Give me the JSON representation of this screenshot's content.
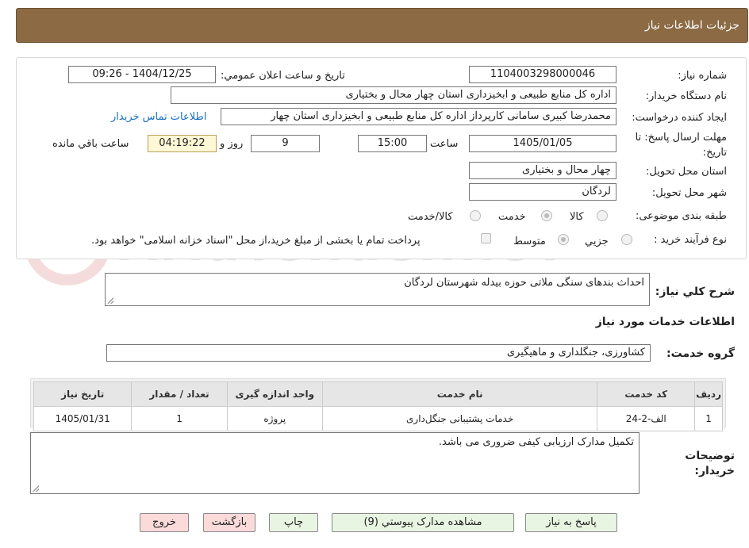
{
  "header": {
    "title": "جزئیات اطلاعات نیاز"
  },
  "form": {
    "need_number_label": "شماره نیاز:",
    "need_number": "1104003298000046",
    "announce_label": "تاریخ و ساعت اعلان عمومي:",
    "announce_value": "1404/12/25 - 09:26",
    "buyer_org_label": "نام دستگاه خریدار:",
    "buyer_org": "اداره کل منابع طبیعی و ابخیزداری استان چهار محال و بختیاری",
    "creator_label": "ایجاد کننده درخواست:",
    "creator": "محمدرضا کبیری سامانی کارپرداز اداره کل منابع طبیعی و ابخیزداری استان چهار",
    "contact_link": "اطلاعات تماس خریدار",
    "deadline_label": "مهلت ارسال پاسخ: تا تاریخ:",
    "deadline_date": "1405/01/05",
    "time_label": "ساعت",
    "deadline_time": "15:00",
    "days": "9",
    "days_label": "روز و",
    "remaining": "04:19:22",
    "remaining_label": "ساعت باقي مانده",
    "province_label": "استان محل تحویل:",
    "province": "چهار محال و بختیاری",
    "city_label": "شهر محل تحویل:",
    "city": "لردگان",
    "category_label": "طبقه بندی موضوعی:",
    "category_options": [
      "کالا",
      "خدمت",
      "کالا/خدمت"
    ],
    "process_label": "نوع فرآیند خرید :",
    "process_options": [
      "جزيي",
      "متوسط"
    ],
    "payment_note": "پرداخت تمام یا بخشی از مبلغ خرید،از محل \"اسناد خزانه اسلامی\" خواهد بود."
  },
  "summary": {
    "label": "شرح کلي نیاز:",
    "text": "احداث بندهای سنگی ملاتی حوزه بیدله شهرستان لردگان"
  },
  "services": {
    "section_title": "اطلاعات خدمات مورد نیاز",
    "group_label": "گروه خدمت:",
    "group_value": "کشاورزی، جنگلداری و ماهیگیری",
    "columns": [
      "ردیف",
      "کد خدمت",
      "نام خدمت",
      "واحد اندازه گیری",
      "تعداد / مقدار",
      "تاریخ نیاز"
    ],
    "rows": [
      [
        "1",
        "الف-2-24",
        "خدمات پشتیبانی جنگل‌داری",
        "پروژه",
        "1",
        "1405/01/31"
      ]
    ]
  },
  "buyer_notes": {
    "label": "توضیحات خریدار:",
    "text": "تکمیل مدارک ارزیابی کیفی ضروری می باشد."
  },
  "buttons": {
    "reply": "پاسخ به نیاز",
    "attachments": "مشاهده مدارک پیوستي (9)",
    "print": "چاپ",
    "back": "بازگشت",
    "exit": "خروج"
  },
  "watermark": {
    "text": "AriaTender.neT"
  },
  "colors": {
    "header_bg": "#8b6a44",
    "button_green": "#e8f5e2",
    "button_pink": "#fbdada",
    "timer_bg": "#fff8d6"
  }
}
